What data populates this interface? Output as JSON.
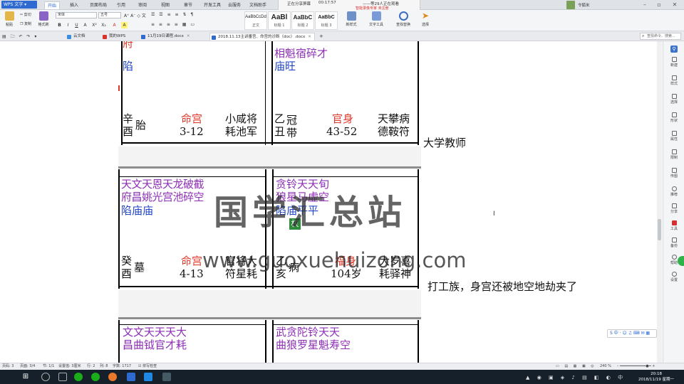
{
  "app": {
    "badge": "WPS 文字 ▾",
    "menu_tabs": [
      "开始",
      "插入",
      "页面布局",
      "引用",
      "审阅",
      "视图",
      "章节",
      "开发工具",
      "云服务",
      "文档助手"
    ],
    "active_tab": "开始"
  },
  "recording": {
    "status": "正在分享屏幕",
    "timer": "00:17:57",
    "viewers": "——等29人正在观看",
    "notice": "智能录像专家 未注册"
  },
  "user": {
    "name": "令狐米"
  },
  "ribbon": {
    "paste": "粘贴",
    "cut": "剪切",
    "copy": "复制",
    "format_painter": "格式刷",
    "font_name": "宋体",
    "font_size": "五号",
    "format_buttons": [
      "B",
      "I",
      "U",
      "A",
      "X²",
      "X₂",
      "A",
      "A"
    ],
    "styles": [
      {
        "preview": "AaBbCcDd",
        "name": "正文"
      },
      {
        "preview": "AaBl",
        "name": "标题 1"
      },
      {
        "preview": "AaBbC",
        "name": "标题 2"
      },
      {
        "preview": "AaBbC",
        "name": "标题 3"
      }
    ],
    "new_style": "新样式",
    "text_tools": "文字工具",
    "find_replace": "查找替换",
    "select": "选择"
  },
  "doc_tabs": [
    {
      "label": "云文档",
      "color": "#3b8de0"
    },
    {
      "label": "我的WPS",
      "color": "#d9302c"
    },
    {
      "label": "11月19日课程.docx",
      "color": "#2f6ad1"
    },
    {
      "label": "2018.11.13主讲番宫、命宫的诊断（doc）.docx",
      "color": "#2f6ad1"
    }
  ],
  "search_placeholder": "查找命令、搜索...",
  "side_panel": [
    "新建",
    "样式",
    "选择",
    "形状",
    "属性",
    "限制",
    "传图",
    "推荐",
    "分享",
    "工具",
    "备份",
    "帮助",
    "设置"
  ],
  "chart": {
    "top_left": {
      "stars_line1": "府",
      "stars_line2": "陷",
      "stem": "辛",
      "branch": "酉",
      "stage": "胎",
      "palace": "命宫",
      "range": "3-12",
      "deities_line1": "小咸将",
      "deities_line2": "耗池军"
    },
    "top_right": {
      "stars_line1": "相魁宿碎才",
      "stars_line2": "庙旺",
      "stem": "乙",
      "branch": "丑",
      "stage": "冠带",
      "palace": "官身",
      "range": "43-52",
      "deities_line1": "天攀病",
      "deities_line2": "德鞍符"
    },
    "mid_left": {
      "stars_line1": "天文天恩天龙破截",
      "stars_line2": "府昌姚光宫池碎空",
      "stars_line3": "陷庙庙",
      "stem": "癸",
      "branch": "酉",
      "stage": "墓",
      "palace": "命宫",
      "range": "4-13",
      "deities_line1": "官将大",
      "deities_line2": "符星耗"
    },
    "mid_right": {
      "stars_line1": "贪铃天天旬",
      "stars_line2": "狼星马虚空",
      "stars_line3": "陷庙平平",
      "badge": "权",
      "stem": "乙",
      "branch": "亥",
      "stage": "病",
      "palace": "福身",
      "range": "104岁",
      "deities_line1": "大岁喜",
      "deities_line2": "耗驿神"
    },
    "bottom_left": {
      "stars_line1": "文文天天天大",
      "stars_line2": "昌曲钺官才耗"
    },
    "bottom_right": {
      "stars_line1": "武贪陀铃天天",
      "stars_line2": "曲狼罗星魁寿空"
    }
  },
  "notes": {
    "note1": "大学教师",
    "note2": "打工族，身宫还被地空地劫夹了"
  },
  "watermark": {
    "title": "国学汇总站",
    "url": "www.guoxuehuizong.com"
  },
  "status": {
    "page_num": "页码: 3",
    "pages": "页面: 3/4",
    "section": "节: 1/1",
    "setting": "设置值: 3厘米",
    "row": "行: 2",
    "col": "列: 8",
    "words": "字数: 1717",
    "spell": "☑ 拼写检查",
    "zoom": "240 %"
  },
  "clock": {
    "time": "20:18",
    "date": "2018/11/19 星期一"
  }
}
